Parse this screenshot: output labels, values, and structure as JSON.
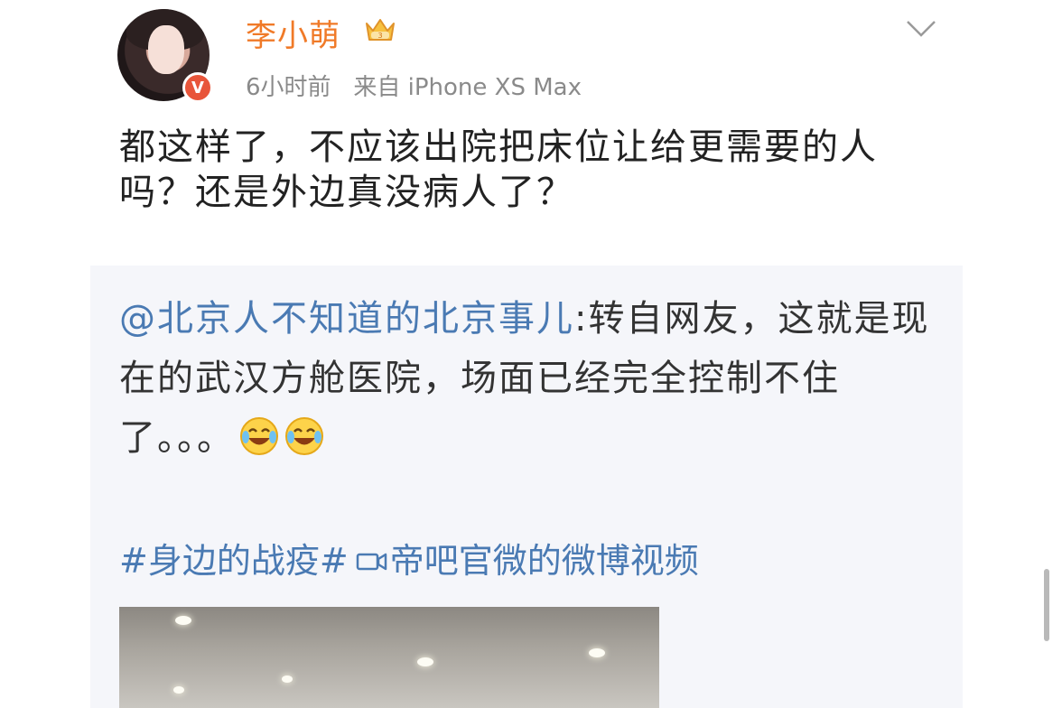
{
  "post": {
    "username": "李小萌",
    "time": "6小时前",
    "source": "来自 iPhone XS Max",
    "text": "都这样了，不应该出院把床位让给更需要的人吗？还是外边真没病人了？",
    "verified_badge": "V"
  },
  "retweet": {
    "mention": "@北京人不知道的北京事儿",
    "text": ":转自网友，这就是现在的武汉方舱医院，场面已经完全控制不住了。。。",
    "hashtag": "#身边的战疫#",
    "video_label": "帝吧官微的微博视频"
  },
  "icons": {
    "crown": "crown-icon",
    "chevron": "chevron-down-icon",
    "laugh": "laugh-cry-icon",
    "video": "video-icon"
  },
  "colors": {
    "username": "#f07a28",
    "link": "#4a7ab3",
    "meta": "#8a8a8a",
    "badge": "#e8553a",
    "retweet_bg": "#f5f6fa"
  }
}
